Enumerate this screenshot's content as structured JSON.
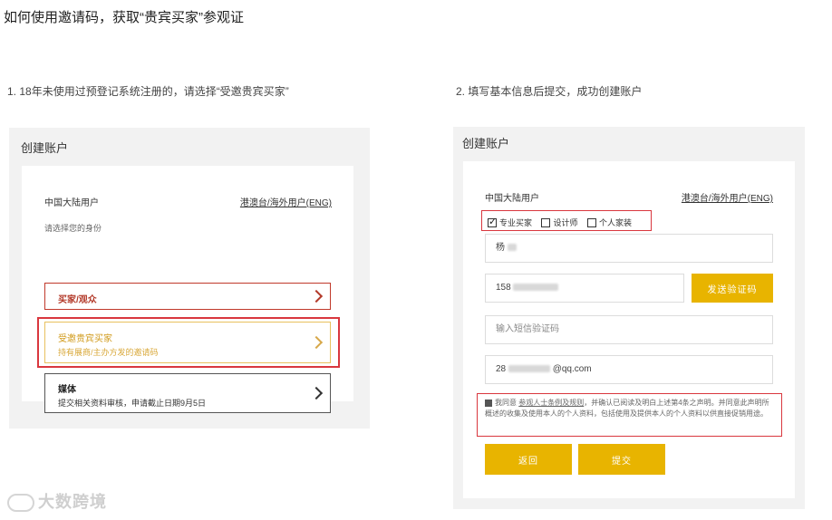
{
  "page_title": "如何使用邀请码，获取“贵宾买家”参观证",
  "step1": {
    "text": "1. 18年未使用过预登记系统注册的，请选择“受邀贵宾买家”",
    "panel_title": "创建账户",
    "region_label": "中国大陆用户",
    "region_link": "港澳台/海外用户(ENG)",
    "identity_prompt": "请选择您的身份",
    "options": [
      {
        "label": "买家/观众",
        "sub": ""
      },
      {
        "label": "受邀贵宾买家",
        "sub": "持有展商/主办方发的邀请码"
      },
      {
        "label": "媒体",
        "sub": "提交相关资料审核，申请截止日期9月5日"
      }
    ]
  },
  "step2": {
    "text": "2. 填写基本信息后提交，成功创建账户",
    "panel_title": "创建账户",
    "region_label": "中国大陆用户",
    "region_link": "港澳台/海外用户(ENG)",
    "roles": [
      {
        "label": "专业买家",
        "checked": true
      },
      {
        "label": "设计师",
        "checked": false
      },
      {
        "label": "个人家装",
        "checked": false
      }
    ],
    "name_value": "杨",
    "phone_value": "158",
    "send_code_button": "发送验证码",
    "sms_placeholder": "输入短信验证码",
    "email_prefix": "28",
    "email_suffix": "@qq.com",
    "agreement": {
      "prefix": "我同意",
      "link": "参观人士条例及规则",
      "text": "，并确认已阅读及明白上述第4条之声明。并同意此声明所概述的收集及使用本人的个人资料，包括使用及提供本人的个人资料以供直接促销用途。"
    },
    "back_button": "返回",
    "submit_button": "提交"
  },
  "watermark": "大数跨境"
}
